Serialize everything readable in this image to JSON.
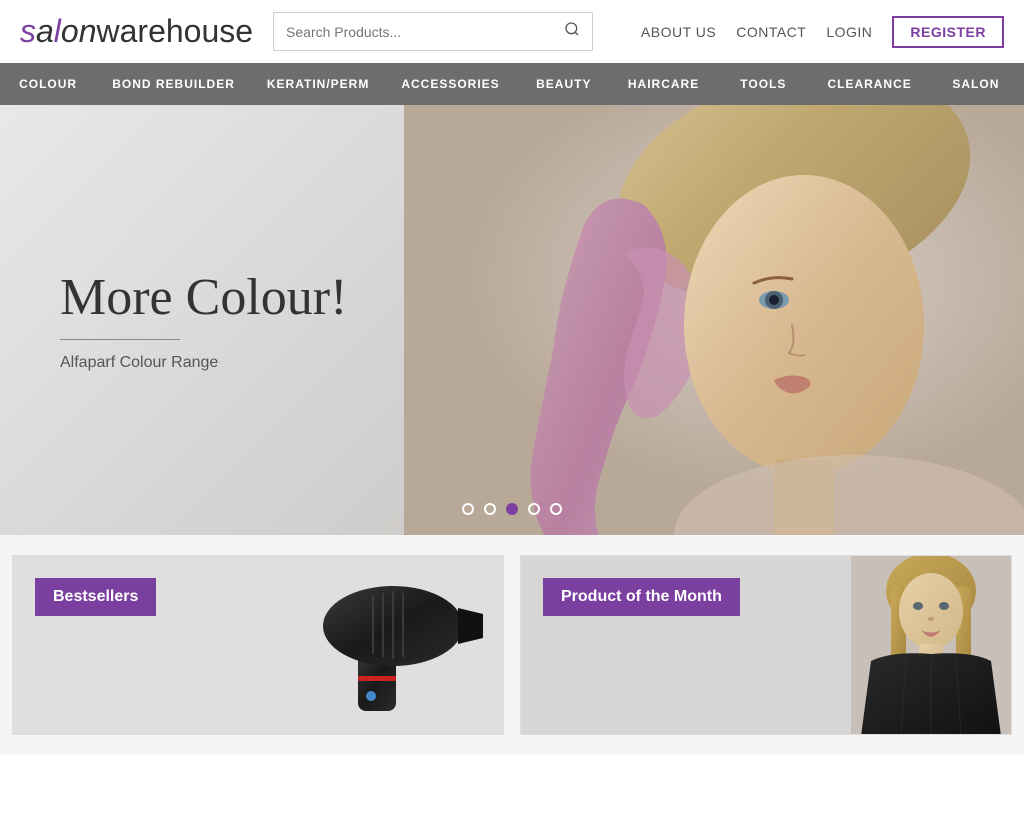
{
  "brand": {
    "name_part1": "sa",
    "name_italic": "l",
    "name_part2": "on",
    "name_part3": "warehouse",
    "logo_text": "salon warehouse"
  },
  "header": {
    "search_placeholder": "Search Products...",
    "nav_links": [
      {
        "id": "about-us",
        "label": "ABOUT US"
      },
      {
        "id": "contact",
        "label": "CONTACT"
      },
      {
        "id": "login",
        "label": "LOGIN"
      },
      {
        "id": "register",
        "label": "REGISTER"
      }
    ]
  },
  "nav_menu": {
    "items": [
      {
        "id": "colour",
        "label": "COLOUR"
      },
      {
        "id": "bond-rebuilder",
        "label": "BOND REBUILDER"
      },
      {
        "id": "keratin-perm",
        "label": "KERATIN/PERM"
      },
      {
        "id": "accessories",
        "label": "ACCESSORIES"
      },
      {
        "id": "beauty",
        "label": "BEAUTY"
      },
      {
        "id": "haircare",
        "label": "HAIRCARE"
      },
      {
        "id": "tools",
        "label": "TOOLS"
      },
      {
        "id": "clearance",
        "label": "CLEARANCE"
      },
      {
        "id": "salon",
        "label": "SALON"
      }
    ]
  },
  "hero": {
    "title": "More Colour!",
    "subtitle": "Alfaparf Colour Range",
    "dots_count": 5,
    "active_dot": 2
  },
  "product_cards": [
    {
      "id": "bestsellers",
      "badge_label": "Bestsellers"
    },
    {
      "id": "product-of-month",
      "badge_label": "Product of the Month"
    }
  ],
  "colors": {
    "brand_purple": "#7b3fa0",
    "nav_bg": "#6d6d6d",
    "text_dark": "#333333"
  }
}
